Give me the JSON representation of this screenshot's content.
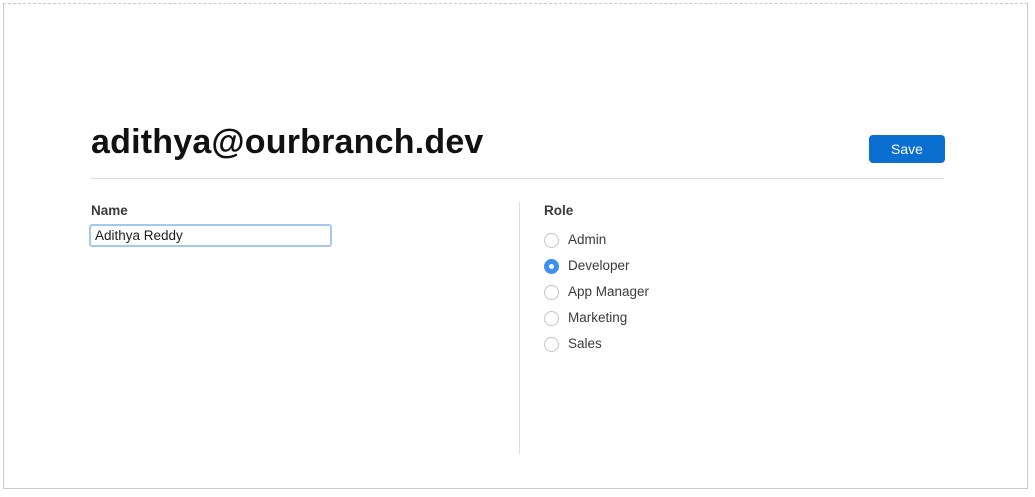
{
  "header": {
    "title": "adithya@ourbranch.dev",
    "save_label": "Save"
  },
  "form": {
    "name_label": "Name",
    "name_value": "Adithya Reddy",
    "role_label": "Role",
    "roles": [
      {
        "label": "Admin",
        "selected": false
      },
      {
        "label": "Developer",
        "selected": true
      },
      {
        "label": "App Manager",
        "selected": false
      },
      {
        "label": "Marketing",
        "selected": false
      },
      {
        "label": "Sales",
        "selected": false
      }
    ]
  },
  "colors": {
    "accent": "#0a6fd0",
    "radio_selected": "#3d8ff2",
    "input_focus_border": "#a5c8ef"
  }
}
